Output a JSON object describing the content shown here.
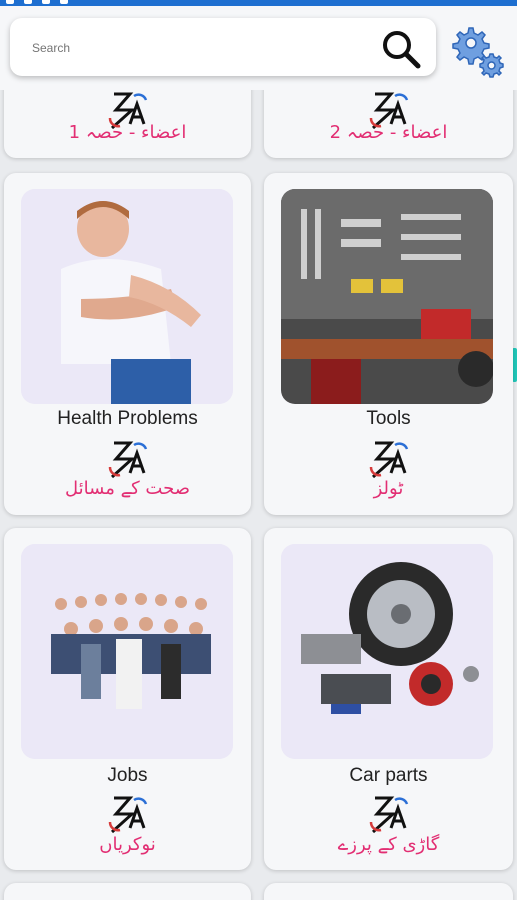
{
  "search": {
    "placeholder": "Search"
  },
  "cards": [
    {
      "en": "",
      "ur": "اعضاء - حصہ 1"
    },
    {
      "en": "",
      "ur": "اعضاء - حصہ 2"
    },
    {
      "en": "Health Problems",
      "ur": "صحت کے مسائل"
    },
    {
      "en": "Tools",
      "ur": "ٹولز"
    },
    {
      "en": "Jobs",
      "ur": "نوکریاں"
    },
    {
      "en": "Car parts",
      "ur": "گاڑی کے پرزے"
    }
  ],
  "colors": {
    "accent_urdu": "#e22e73",
    "status_bar": "#1e6fd0",
    "gear_icon": "#3b7ad1"
  },
  "icons": {
    "search": "search-icon",
    "settings": "gear-icon",
    "app": "translate-logo-icon"
  }
}
